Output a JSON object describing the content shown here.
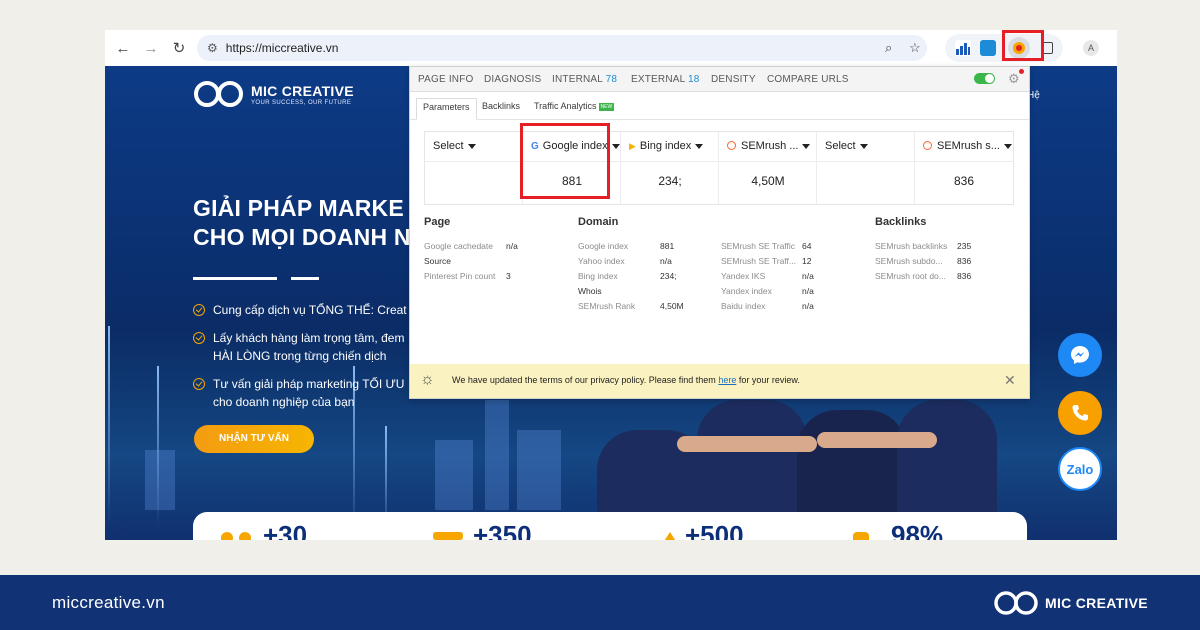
{
  "browser": {
    "url": "https://miccreative.vn",
    "avatar_letter": "A"
  },
  "site": {
    "logo_name": "MIC CREATIVE",
    "logo_tagline": "YOUR SUCCESS, OUR FUTURE",
    "nav_partial": "Hệ",
    "hero_line1": "GIẢI PHÁP MARKE",
    "hero_line2": "CHO MỌI DOANH N",
    "bullets": [
      {
        "line1": "Cung cấp dịch vụ TỔNG THỂ: Creat",
        "line2": ""
      },
      {
        "line1": "Lấy khách hàng làm trọng tâm, đem",
        "line2": "HÀI LÒNG trong từng chiến dịch"
      },
      {
        "line1": "Tư vấn giải pháp marketing TỐI ƯU",
        "line2": "cho doanh nghiệp của bạn"
      }
    ],
    "cta_label": "NHẬN TƯ VẤN",
    "stats": [
      "+30",
      "+350",
      "+500",
      "98%"
    ],
    "zalo_label": "Zalo"
  },
  "panel": {
    "tabs": [
      {
        "label": "PAGE INFO",
        "count": ""
      },
      {
        "label": "DIAGNOSIS",
        "count": ""
      },
      {
        "label": "INTERNAL",
        "count": "78"
      },
      {
        "label": "EXTERNAL",
        "count": "18"
      },
      {
        "label": "DENSITY",
        "count": ""
      },
      {
        "label": "COMPARE URLS",
        "count": ""
      }
    ],
    "subtabs": [
      "Parameters",
      "Backlinks",
      "Traffic Analytics"
    ],
    "new_badge": "NEW",
    "metrics": [
      {
        "label": "Select",
        "value": "",
        "icon": "none"
      },
      {
        "label": "Google index",
        "value": "881",
        "icon": "google-icon"
      },
      {
        "label": "Bing index",
        "value": "234;",
        "icon": "bing-icon"
      },
      {
        "label": "SEMrush ...",
        "value": "4,50M",
        "icon": "semrush-icon"
      },
      {
        "label": "Select",
        "value": "",
        "icon": "none"
      },
      {
        "label": "SEMrush s...",
        "value": "836",
        "icon": "semrush-icon"
      }
    ],
    "page_section": {
      "title": "Page",
      "rows": [
        {
          "label": "Google cachedate",
          "value": "n/a"
        },
        {
          "label": "Source",
          "value": ""
        },
        {
          "label": "Pinterest Pin count",
          "value": "3"
        }
      ]
    },
    "domain_section": {
      "title": "Domain",
      "col1": [
        {
          "label": "Google index",
          "value": "881"
        },
        {
          "label": "Yahoo index",
          "value": "n/a"
        },
        {
          "label": "Bing index",
          "value": "234;"
        },
        {
          "label": "Whois",
          "value": ""
        },
        {
          "label": "SEMrush Rank",
          "value": "4,50M"
        }
      ],
      "col2": [
        {
          "label": "SEMrush SE Traffic",
          "value": "64"
        },
        {
          "label": "SEMrush SE Traff...",
          "value": "12"
        },
        {
          "label": "Yandex IKS",
          "value": "n/a"
        },
        {
          "label": "Yandex index",
          "value": "n/a"
        },
        {
          "label": "Baidu index",
          "value": "n/a"
        }
      ]
    },
    "backlinks_section": {
      "title": "Backlinks",
      "rows": [
        {
          "label": "SEMrush backlinks",
          "value": "235"
        },
        {
          "label": "SEMrush subdo...",
          "value": "836"
        },
        {
          "label": "SEMrush root do...",
          "value": "836"
        }
      ]
    },
    "notice": {
      "before": "We have updated the terms of our privacy policy. Please find them ",
      "link": "here",
      "after": " for your review."
    }
  },
  "footer": {
    "url": "miccreative.vn",
    "brand": "MIC CREATIVE"
  },
  "colors": {
    "highlight": "#e41f26",
    "accent_orange": "#f7a600",
    "footer_bg": "#113274"
  }
}
